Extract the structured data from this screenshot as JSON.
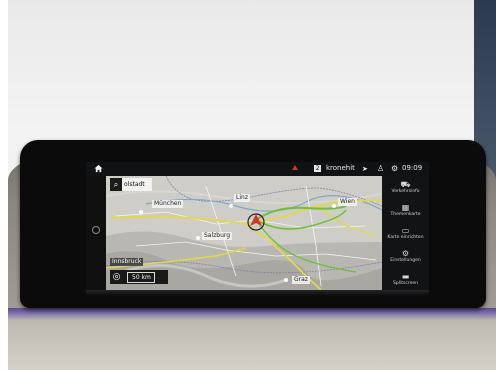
{
  "status_bar": {
    "home_icon": "home-icon",
    "alert_icon": "red-triangle-icon",
    "radio_preset": "2",
    "radio_station": "kronehit",
    "nav_icon": "navigation-arrow-icon",
    "profile_icon": "person-icon",
    "settings_icon": "gear-icon",
    "time": "09:09"
  },
  "map": {
    "search_text": "olstadt",
    "scale": "50 km",
    "colors": {
      "road_main": "#e2d84a",
      "road_alt": "#6fbf3d",
      "position_marker": "#d8342b"
    },
    "labels": [
      {
        "id": "munchen",
        "text": "München"
      },
      {
        "id": "linz",
        "text": "Linz"
      },
      {
        "id": "wien",
        "text": "Wien"
      },
      {
        "id": "salzburg",
        "text": "Salzburg"
      },
      {
        "id": "innsbruck",
        "text": "Innsbruck"
      },
      {
        "id": "graz",
        "text": "Graz"
      }
    ]
  },
  "panel": {
    "items": [
      {
        "icon": "traffic-icon",
        "label": "Verkehrsinfo"
      },
      {
        "icon": "map-theme-icon",
        "label": "Themenkarte"
      },
      {
        "icon": "car-map-icon",
        "label": "Karte einrichten"
      },
      {
        "icon": "gear-icon",
        "label": "Einstellungen"
      },
      {
        "icon": "split-screen-icon",
        "label": "Splitscreen"
      }
    ]
  }
}
